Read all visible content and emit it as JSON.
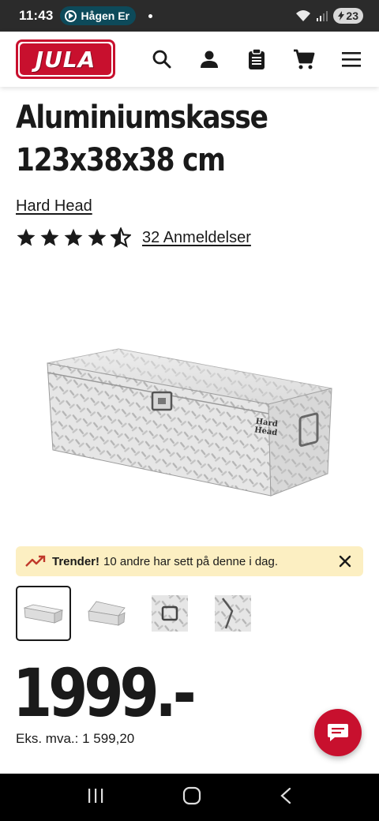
{
  "status_bar": {
    "time": "11:43",
    "media_pill": "Hågen Er",
    "battery": "23"
  },
  "header": {
    "logo_text": "JULA",
    "icons": [
      "search-icon",
      "account-icon",
      "clipboard-icon",
      "cart-icon",
      "menu-icon"
    ]
  },
  "product": {
    "title_line1": "Aluminiumskasse",
    "title_line2": "123x38x38 cm",
    "brand": "Hard Head",
    "rating": 4.5,
    "reviews_label": "32 Anmeldelser",
    "image_brand_mark": "Hard Head"
  },
  "trend_banner": {
    "bold": "Trender!",
    "text": "10 andre har sett på denne i dag."
  },
  "thumbnails": [
    {
      "name": "thumbnail-closed-box",
      "active": true
    },
    {
      "name": "thumbnail-open-box",
      "active": false
    },
    {
      "name": "thumbnail-handle-detail",
      "active": false
    },
    {
      "name": "thumbnail-hinge-detail",
      "active": false
    }
  ],
  "price": {
    "value": "1999.-",
    "ex_vat": "Eks. mva.: 1 599,20"
  },
  "colors": {
    "brand_red": "#c8102e",
    "trend_bg": "#fcefc2",
    "status_bar": "#2b2b2b"
  }
}
